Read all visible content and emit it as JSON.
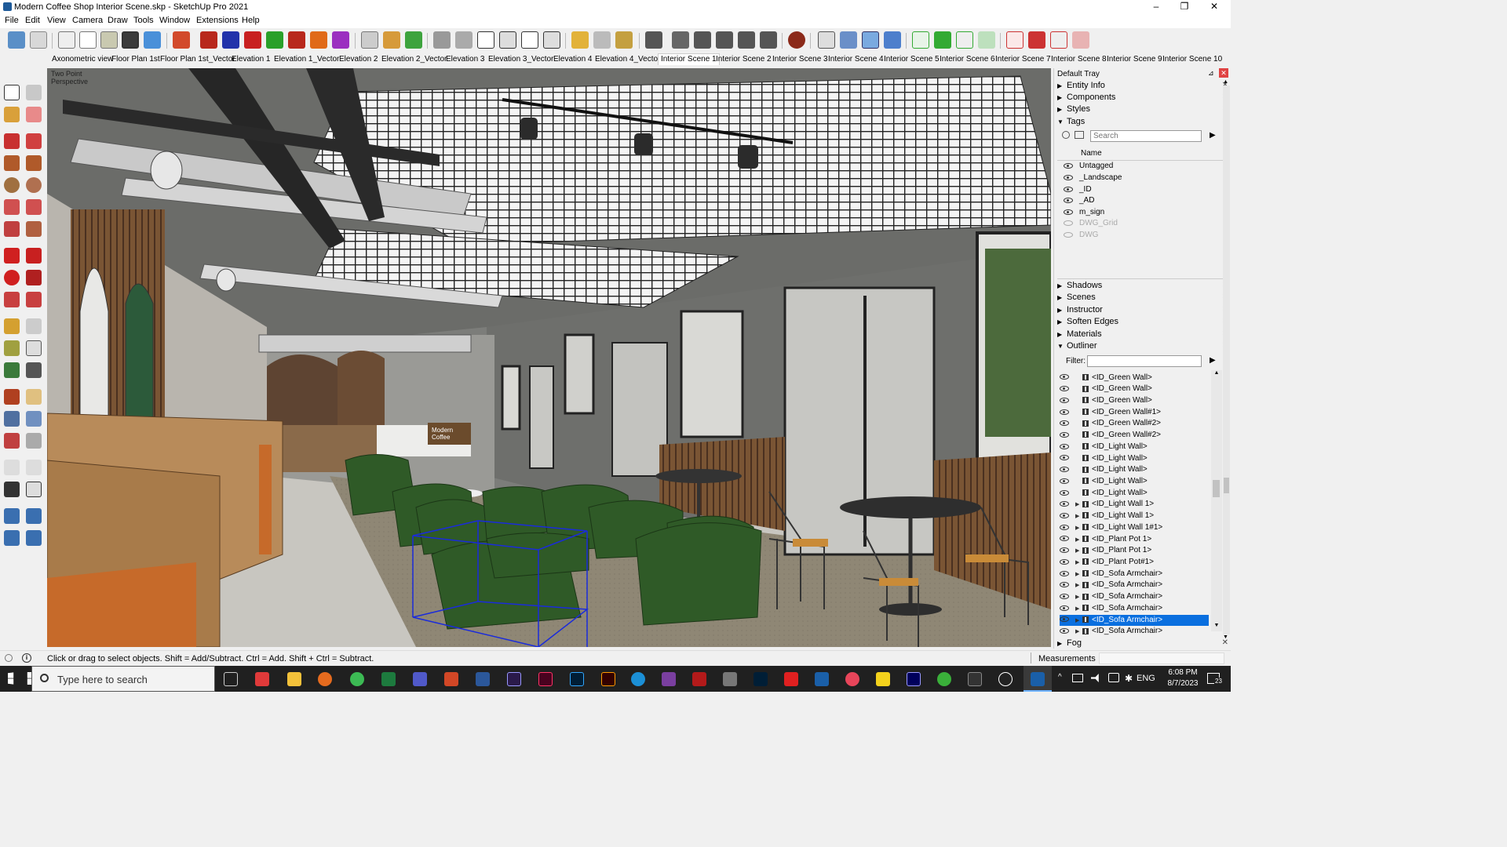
{
  "window": {
    "title": "Modern Coffee Shop Interior Scene.skp - SketchUp Pro 2021",
    "min": "–",
    "max": "❐",
    "close": "✕"
  },
  "menu": [
    "File",
    "Edit",
    "View",
    "Camera",
    "Draw",
    "Tools",
    "Window",
    "Extensions",
    "Help"
  ],
  "scenes": [
    "Axonometric view",
    "Floor Plan 1st",
    "Floor Plan 1st_Vector",
    "Elevation 1",
    "Elevation 1_Vector",
    "Elevation 2",
    "Elevation 2_Vector",
    "Elevation 3",
    "Elevation 3_Vector",
    "Elevation 4",
    "Elevation 4_Vector",
    "Interior Scene 1",
    "Interior Scene 2",
    "Interior Scene 3",
    "Interior Scene 4",
    "Interior Scene 5",
    "Interior Scene 6",
    "Interior Scene 7",
    "Interior Scene 8",
    "Interior Scene 9",
    "Interior Scene 10"
  ],
  "active_scene": "Interior Scene 1",
  "viewport": {
    "label_line1": "Two Point",
    "label_line2": "Perspective",
    "sign_line1": "Modern",
    "sign_line2": "Coffee"
  },
  "tray": {
    "title": "Default Tray",
    "collapsed_top": [
      "Entity Info",
      "Components",
      "Styles"
    ],
    "tags_label": "Tags",
    "tags_search_placeholder": "Search",
    "tags_col_name": "Name",
    "tags": [
      {
        "name": "Untagged",
        "visible": true
      },
      {
        "name": "_Landscape",
        "visible": true
      },
      {
        "name": "_ID",
        "visible": true
      },
      {
        "name": "_AD",
        "visible": true
      },
      {
        "name": "m_sign",
        "visible": true
      },
      {
        "name": "DWG_Grid",
        "visible": false
      },
      {
        "name": "DWG",
        "visible": false
      }
    ],
    "collapsed_mid": [
      "Shadows",
      "Scenes",
      "Instructor",
      "Soften Edges",
      "Materials"
    ],
    "outliner_label": "Outliner",
    "filter_label": "Filter:",
    "outliner": [
      "<ID_Green Wall>",
      "<ID_Green Wall>",
      "<ID_Green Wall>",
      "<ID_Green Wall#1>",
      "<ID_Green Wall#2>",
      "<ID_Green Wall#2>",
      "<ID_Light Wall>",
      "<ID_Light Wall>",
      "<ID_Light Wall>",
      "<ID_Light Wall>",
      "<ID_Light Wall>",
      "<ID_Light Wall 1>",
      "<ID_Light Wall 1>",
      "<ID_Light Wall 1#1>",
      "<ID_Plant Pot 1>",
      "<ID_Plant Pot 1>",
      "<ID_Plant Pot#1>",
      "<ID_Sofa Armchair>",
      "<ID_Sofa Armchair>",
      "<ID_Sofa Armchair>",
      "<ID_Sofa Armchair>",
      "<ID_Sofa Armchair>",
      "<ID_Sofa Armchair>"
    ],
    "outliner_selected_index": 21,
    "fog_label": "Fog"
  },
  "status": {
    "hint": "Click or drag to select objects. Shift = Add/Subtract. Ctrl = Add. Shift + Ctrl = Subtract.",
    "measurements_label": "Measurements"
  },
  "taskbar": {
    "search_placeholder": "Type here to search",
    "lang": "ENG",
    "time": "6:08 PM",
    "date": "8/7/2023",
    "notif": "23"
  },
  "colors": {
    "accent": "#0a6fdf",
    "taskbar": "#202020"
  }
}
